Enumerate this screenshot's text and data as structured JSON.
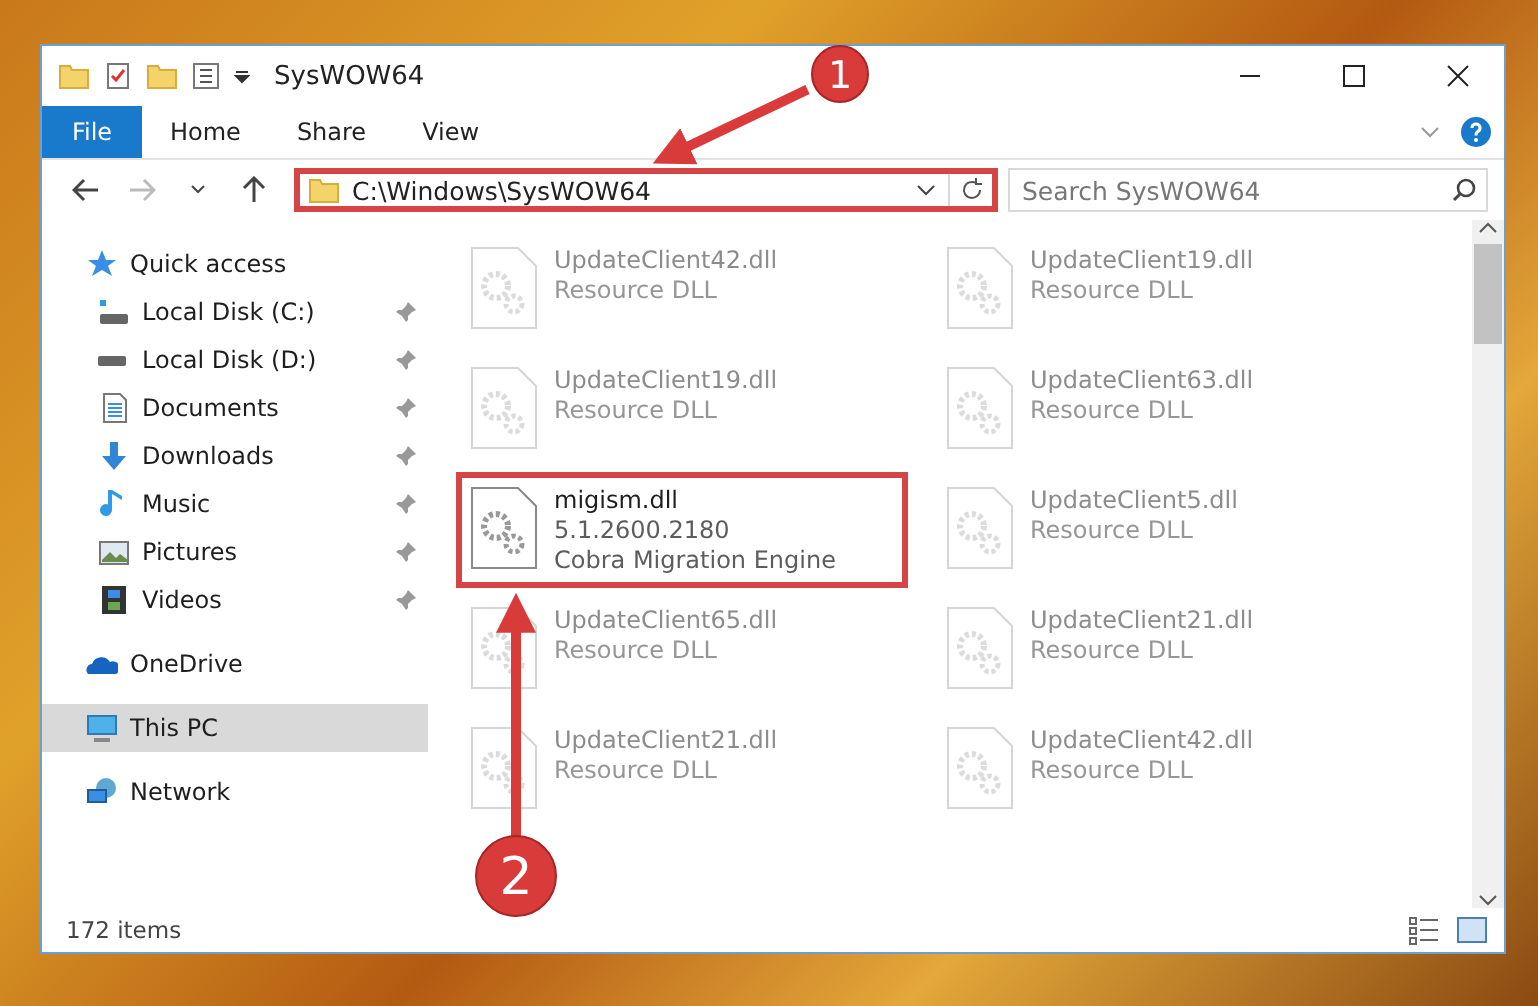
{
  "window": {
    "title": "SysWOW64"
  },
  "ribbon": {
    "tabs": [
      {
        "label": "File",
        "kind": "file",
        "selected": false
      },
      {
        "label": "Home",
        "kind": "tab",
        "selected": false
      },
      {
        "label": "Share",
        "kind": "tab",
        "selected": false
      },
      {
        "label": "View",
        "kind": "tab",
        "selected": false
      }
    ]
  },
  "address_bar": {
    "path": "C:\\Windows\\SysWOW64",
    "highlighted": true
  },
  "search": {
    "placeholder": "Search SysWOW64"
  },
  "navigation": [
    {
      "label": "Quick access",
      "kind": "star",
      "selected": false,
      "children": [
        {
          "label": "Local Disk (C:)",
          "kind": "disk-c",
          "pinned": true,
          "selected": false
        },
        {
          "label": "Local Disk (D:)",
          "kind": "disk",
          "pinned": true,
          "selected": false
        },
        {
          "label": "Documents",
          "kind": "documents",
          "pinned": true,
          "selected": false
        },
        {
          "label": "Downloads",
          "kind": "downloads",
          "pinned": true,
          "selected": false
        },
        {
          "label": "Music",
          "kind": "music",
          "pinned": true,
          "selected": false
        },
        {
          "label": "Pictures",
          "kind": "pictures",
          "pinned": true,
          "selected": false
        },
        {
          "label": "Videos",
          "kind": "videos",
          "pinned": true,
          "selected": false
        }
      ]
    },
    {
      "label": "OneDrive",
      "kind": "cloud",
      "selected": false
    },
    {
      "label": "This PC",
      "kind": "pc",
      "selected": true
    },
    {
      "label": "Network",
      "kind": "network",
      "selected": false
    }
  ],
  "files": [
    {
      "name": "UpdateClient42.dll",
      "details": [
        "Resource DLL"
      ],
      "faded": true,
      "highlighted": false
    },
    {
      "name": "UpdateClient19.dll",
      "details": [
        "Resource DLL"
      ],
      "faded": true,
      "highlighted": false
    },
    {
      "name": "UpdateClient19.dll",
      "details": [
        "Resource DLL"
      ],
      "faded": true,
      "highlighted": false
    },
    {
      "name": "UpdateClient63.dll",
      "details": [
        "Resource DLL"
      ],
      "faded": true,
      "highlighted": false
    },
    {
      "name": "migism.dll",
      "details": [
        "5.1.2600.2180",
        "Cobra Migration Engine"
      ],
      "faded": false,
      "highlighted": true
    },
    {
      "name": "UpdateClient5.dll",
      "details": [
        "Resource DLL"
      ],
      "faded": true,
      "highlighted": false
    },
    {
      "name": "UpdateClient65.dll",
      "details": [
        "Resource DLL"
      ],
      "faded": true,
      "highlighted": false
    },
    {
      "name": "UpdateClient21.dll",
      "details": [
        "Resource DLL"
      ],
      "faded": true,
      "highlighted": false
    },
    {
      "name": "UpdateClient21.dll",
      "details": [
        "Resource DLL"
      ],
      "faded": true,
      "highlighted": false
    },
    {
      "name": "UpdateClient42.dll",
      "details": [
        "Resource DLL"
      ],
      "faded": true,
      "highlighted": false
    }
  ],
  "status_bar": {
    "count": "172 items"
  },
  "annotations": [
    {
      "number": "1"
    },
    {
      "number": "2"
    }
  ]
}
